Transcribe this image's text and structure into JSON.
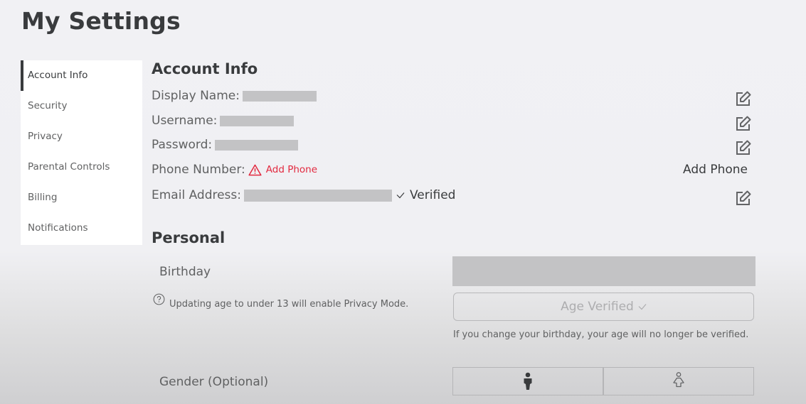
{
  "page": {
    "title": "My Settings"
  },
  "sidebar": {
    "items": [
      {
        "label": "Account Info",
        "active": true
      },
      {
        "label": "Security"
      },
      {
        "label": "Privacy"
      },
      {
        "label": "Parental Controls"
      },
      {
        "label": "Billing"
      },
      {
        "label": "Notifications"
      }
    ]
  },
  "account_info": {
    "title": "Account Info",
    "display_name_label": "Display Name:",
    "username_label": "Username:",
    "password_label": "Password:",
    "phone_label": "Phone Number:",
    "phone_add_link": "Add Phone",
    "phone_add_button": "Add Phone",
    "email_label": "Email Address:",
    "email_status": "Verified",
    "edit_icon": "edit-icon",
    "warning_icon": "warning-icon",
    "warning_color": "#e2293f"
  },
  "personal": {
    "title": "Personal",
    "birthday_label": "Birthday",
    "privacy_hint": "Updating age to under 13 will enable Privacy Mode.",
    "age_verified_button": "Age Verified",
    "birthday_note": "If you change your birthday, your age will no longer be verified.",
    "gender_label": "Gender (Optional)",
    "gender_options": [
      "male",
      "female"
    ]
  }
}
